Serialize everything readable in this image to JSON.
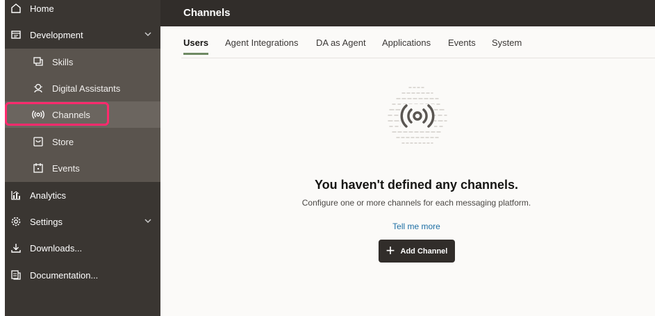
{
  "sidebar": {
    "items": [
      {
        "label": "Home",
        "icon": "home-icon"
      },
      {
        "label": "Development",
        "icon": "development-icon"
      },
      {
        "label": "Skills",
        "icon": "skills-icon"
      },
      {
        "label": "Digital Assistants",
        "icon": "digital-assistant-icon"
      },
      {
        "label": "Channels",
        "icon": "broadcast-icon"
      },
      {
        "label": "Store",
        "icon": "store-icon"
      },
      {
        "label": "Events",
        "icon": "events-icon"
      },
      {
        "label": "Analytics",
        "icon": "analytics-icon"
      },
      {
        "label": "Settings",
        "icon": "gear-icon"
      },
      {
        "label": "Downloads...",
        "icon": "download-icon"
      },
      {
        "label": "Documentation...",
        "icon": "documentation-icon"
      }
    ],
    "selected": "Channels"
  },
  "header": {
    "title": "Channels"
  },
  "tabs": [
    {
      "label": "Users",
      "active": true
    },
    {
      "label": "Agent Integrations",
      "active": false
    },
    {
      "label": "DA as Agent",
      "active": false
    },
    {
      "label": "Applications",
      "active": false
    },
    {
      "label": "Events",
      "active": false
    },
    {
      "label": "System",
      "active": false
    }
  ],
  "empty_state": {
    "title": "You haven't defined any channels.",
    "description": "Configure one or more channels for each messaging platform.",
    "link": "Tell me more",
    "button": "Add Channel"
  },
  "colors": {
    "sidebar": "#3a3632",
    "sidebar_sub": "#5a544e",
    "header": "#312d2a",
    "highlight": "#ff2a6d",
    "tab_underline": "#6e8a63",
    "link": "#1c6ea4"
  }
}
